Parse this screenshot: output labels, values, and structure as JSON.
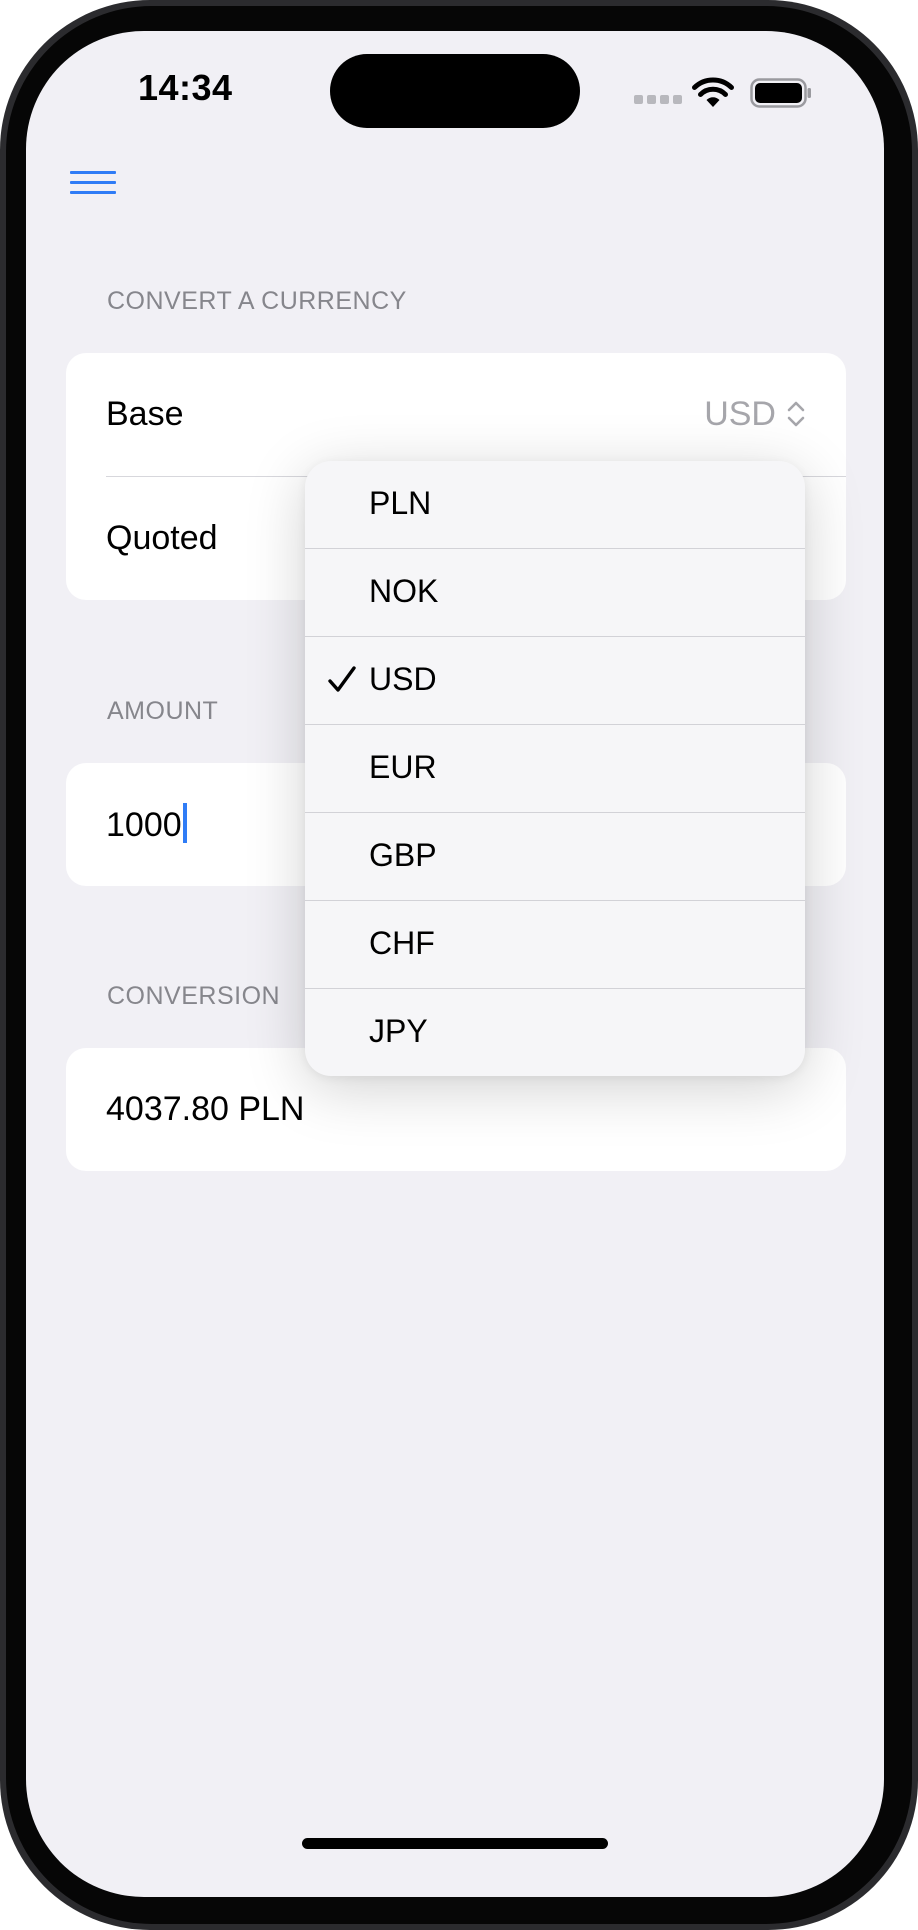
{
  "status_bar": {
    "time": "14:34"
  },
  "icons": {
    "menu": "hamburger-menu-icon",
    "wifi": "wifi-icon",
    "battery": "battery-icon",
    "signal": "cellular-signal-icon",
    "check": "checkmark-icon",
    "chevrons": "up-down-chevron-icon"
  },
  "colors": {
    "accent": "#2f7cf6",
    "background": "#f1f0f5",
    "secondary_text": "#86868c"
  },
  "convert_section": {
    "header": "CONVERT A CURRENCY",
    "base_label": "Base",
    "base_value": "USD",
    "quoted_label": "Quoted"
  },
  "amount_section": {
    "header": "AMOUNT",
    "value": "1000"
  },
  "conversion_section": {
    "header": "CONVERSION",
    "value": "4037.80 PLN"
  },
  "dropdown": {
    "selected": "USD",
    "options": [
      "PLN",
      "NOK",
      "USD",
      "EUR",
      "GBP",
      "CHF",
      "JPY"
    ]
  }
}
